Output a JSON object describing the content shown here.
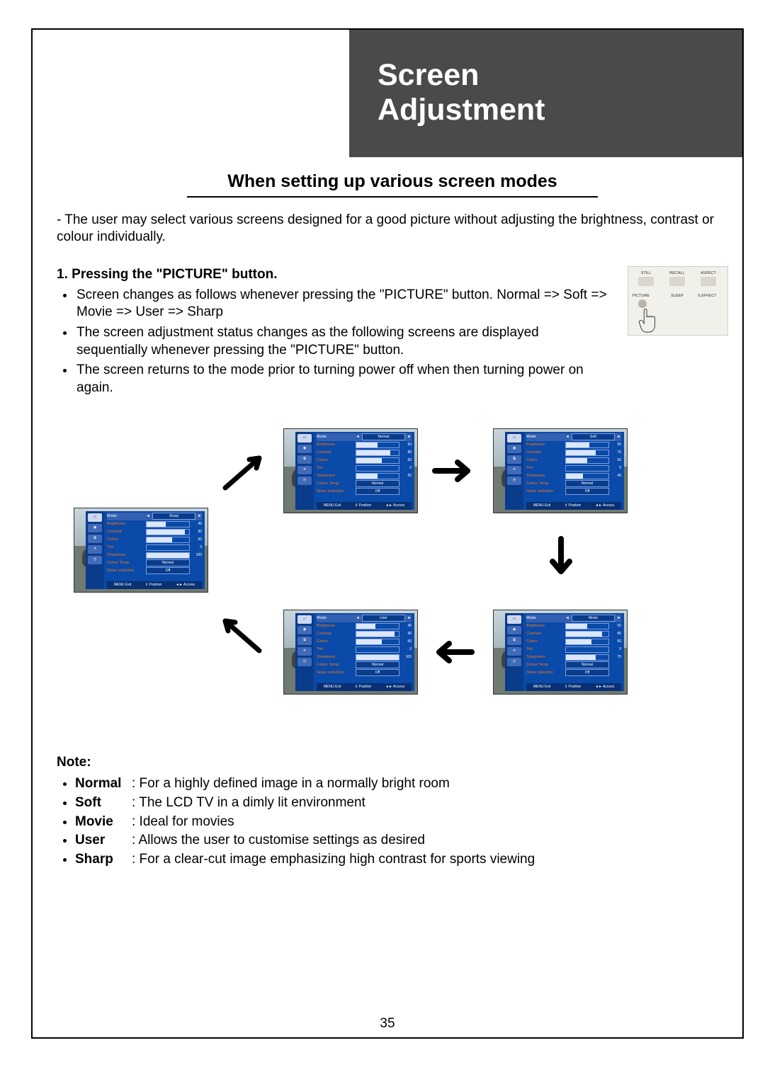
{
  "chapter": {
    "line1": "Screen",
    "line2": "Adjustment"
  },
  "section_title": "When setting up various screen modes",
  "intro": "- The user may select various screens designed for a good picture without adjusting the brightness, contrast or colour individually.",
  "step": {
    "num": "1.",
    "heading": "Pressing the \"PICTURE\" button.",
    "bullets": [
      "Screen changes as follows whenever pressing the \"PICTURE\" button. Normal => Soft => Movie => User => Sharp",
      "The screen adjustment status changes as the following screens are displayed sequentially whenever pressing the \"PICTURE\" button.",
      "The screen returns to the mode prior to turning power off when then turning power on again."
    ]
  },
  "remote": {
    "labels": [
      "STILL",
      "RECALL",
      "ASPECT",
      "PICTURE",
      "SLEEP",
      "S.EFFECT"
    ]
  },
  "osd": {
    "tabs": [
      "Picture",
      "Sound",
      "Install",
      "Utilities",
      "Timer"
    ],
    "footer": {
      "exit": "MENU Exit",
      "position": "⇕ Position",
      "access": "◄► Access"
    },
    "rows": {
      "mode": "Mode",
      "brightness": "Brightness",
      "contrast": "Contrast",
      "colour": "Colour",
      "tint": "Tint",
      "sharpness": "Sharpness",
      "ctemp": "Colour Temp.",
      "noise": "Noise reduction"
    },
    "pills": {
      "normal": "Normal",
      "off": "Off"
    }
  },
  "screens": [
    {
      "id": "normal",
      "mode": "Normal",
      "brightness": 50,
      "contrast": 80,
      "colour": 60,
      "tint": 0,
      "sharpness": 50
    },
    {
      "id": "soft",
      "mode": "Soft",
      "brightness": 55,
      "contrast": 70,
      "colour": 50,
      "tint": 0,
      "sharpness": 40
    },
    {
      "id": "movie",
      "mode": "Movie",
      "brightness": 50,
      "contrast": 85,
      "colour": 60,
      "tint": 0,
      "sharpness": 70
    },
    {
      "id": "user",
      "mode": "User",
      "brightness": 45,
      "contrast": 90,
      "colour": 60,
      "tint": 0,
      "sharpness": 100
    },
    {
      "id": "sharp",
      "mode": "Sharp",
      "brightness": 45,
      "contrast": 90,
      "colour": 60,
      "tint": 0,
      "sharpness": 100
    }
  ],
  "notes": {
    "heading": "Note:",
    "items": [
      {
        "term": "Normal",
        "desc": ": For a highly defined image in a normally bright room"
      },
      {
        "term": "Soft",
        "desc": ": The LCD TV in a dimly lit environment"
      },
      {
        "term": "Movie",
        "desc": ": Ideal for movies"
      },
      {
        "term": "User",
        "desc": ": Allows the user to customise settings as desired"
      },
      {
        "term": "Sharp",
        "desc": ": For a clear-cut image emphasizing high contrast for sports viewing"
      }
    ]
  },
  "page_number": "35"
}
